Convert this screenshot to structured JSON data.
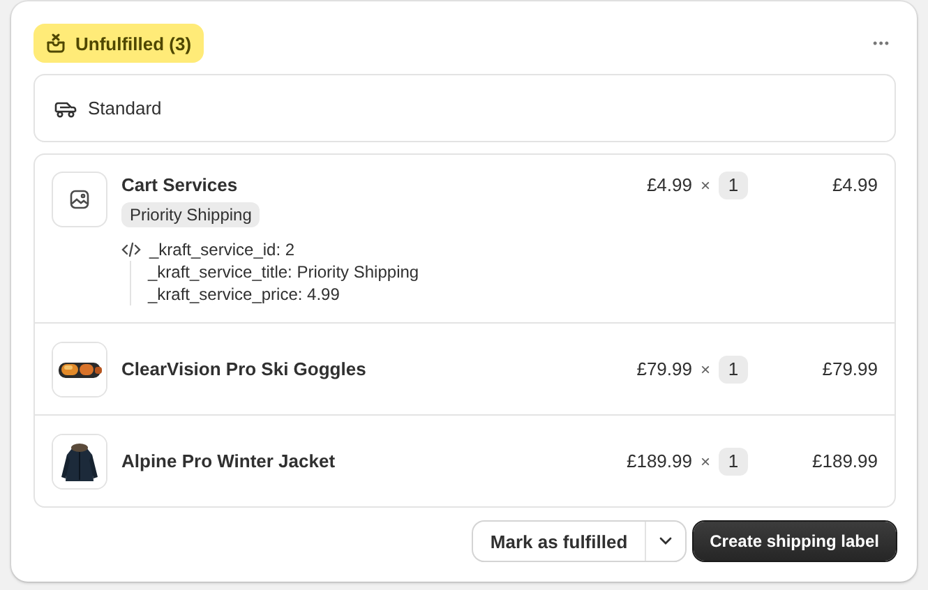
{
  "status_badge": {
    "label": "Unfulfilled (3)"
  },
  "more_actions": {
    "label": "•••"
  },
  "delivery": {
    "method": "Standard"
  },
  "items": [
    {
      "kind": "service",
      "name": "Cart Services",
      "variant": "Priority Shipping",
      "properties": [
        "_kraft_service_id: 2",
        "_kraft_service_title: Priority Shipping",
        "_kraft_service_price: 4.99"
      ],
      "unit_price": "£4.99",
      "times": "×",
      "quantity": "1",
      "total": "£4.99"
    },
    {
      "kind": "product",
      "name": "ClearVision Pro Ski Goggles",
      "unit_price": "£79.99",
      "times": "×",
      "quantity": "1",
      "total": "£79.99"
    },
    {
      "kind": "product",
      "name": "Alpine Pro Winter Jacket",
      "unit_price": "£189.99",
      "times": "×",
      "quantity": "1",
      "total": "£189.99"
    }
  ],
  "actions": {
    "secondary": "Mark as fulfilled",
    "primary": "Create shipping label"
  }
}
